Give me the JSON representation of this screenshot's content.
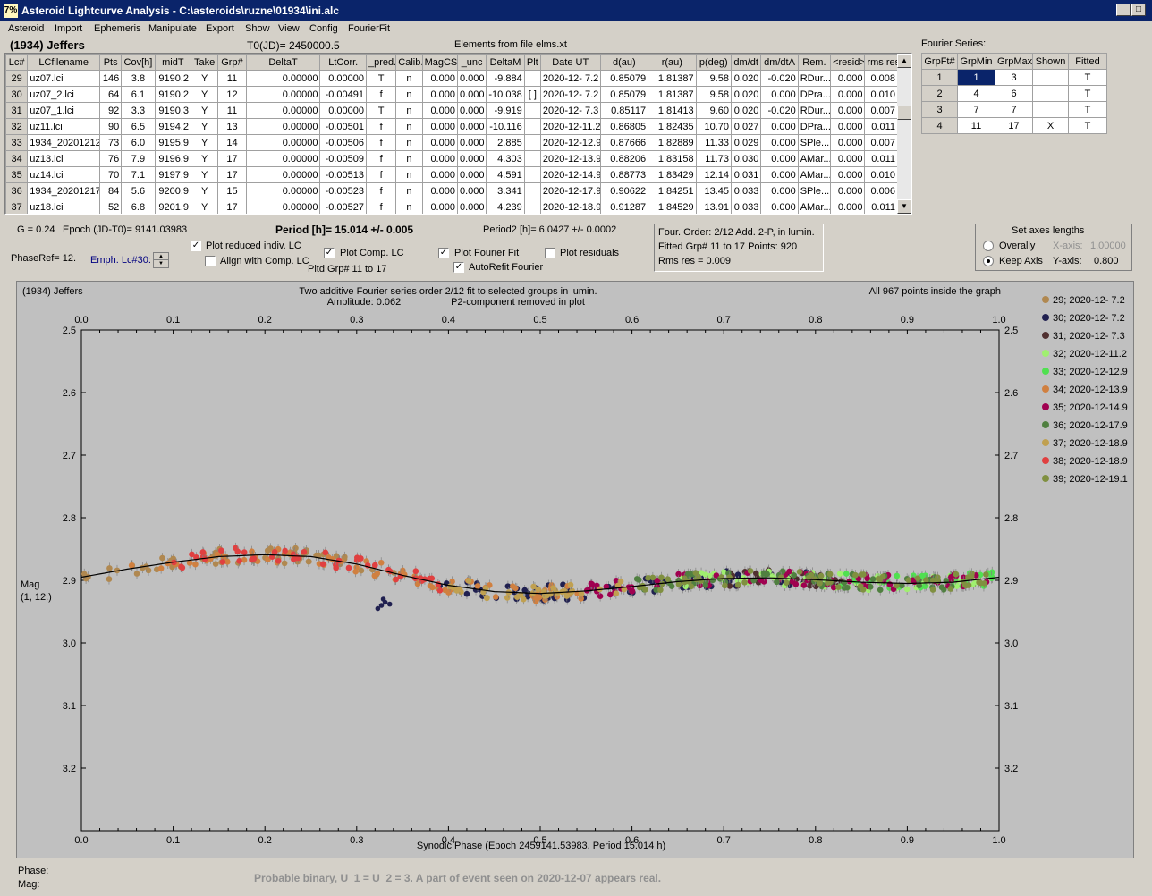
{
  "window": {
    "title": "Asteroid Lightcurve Analysis - C:\\asteroids\\ruzne\\01934\\ini.alc",
    "icon": "7%",
    "min": "_",
    "max": "□",
    "close": "×"
  },
  "menu": [
    "Asteroid",
    "Import",
    "Ephemeris",
    "Manipulate",
    "Export",
    "Show",
    "View",
    "Config",
    "FourierFit"
  ],
  "asteroid_name": "(1934) Jeffers",
  "t0": "T0(JD)= 2450000.5",
  "elements_label": "Elements from file elms.xt",
  "lc_table": {
    "columns": [
      "Lc#",
      "LCfilename",
      "Pts",
      "Cov[h]",
      "midT",
      "Take",
      "Grp#",
      "DeltaT",
      "LtCorr.",
      "_pred.",
      "Calib.",
      "MagCS",
      "_unc",
      "DeltaM",
      "Plt",
      "Date UT",
      "d(au)",
      "r(au)",
      "p(deg)",
      "dm/dt",
      "dm/dtA",
      "Rem.",
      "<resid>",
      "rms res"
    ],
    "rows": [
      [
        "29",
        "uz07.lci",
        "146",
        "3.8",
        "9190.2",
        "Y",
        "11",
        "0.00000",
        "0.00000",
        "T",
        "n",
        "0.000",
        "0.000",
        "-9.884",
        "",
        "2020-12- 7.2",
        "0.85079",
        "1.81387",
        "9.58",
        "0.020",
        "-0.020",
        "RDur...",
        "0.000",
        "0.008"
      ],
      [
        "30",
        "uz07_2.lci",
        "64",
        "6.1",
        "9190.2",
        "Y",
        "12",
        "0.00000",
        "-0.00491",
        "f",
        "n",
        "0.000",
        "0.000",
        "-10.038",
        "[ ]",
        "2020-12- 7.2",
        "0.85079",
        "1.81387",
        "9.58",
        "0.020",
        "0.000",
        "DPra...",
        "0.000",
        "0.010"
      ],
      [
        "31",
        "uz07_1.lci",
        "92",
        "3.3",
        "9190.3",
        "Y",
        "11",
        "0.00000",
        "0.00000",
        "T",
        "n",
        "0.000",
        "0.000",
        "-9.919",
        "",
        "2020-12- 7.3",
        "0.85117",
        "1.81413",
        "9.60",
        "0.020",
        "-0.020",
        "RDur...",
        "0.000",
        "0.007"
      ],
      [
        "32",
        "uz11.lci",
        "90",
        "6.5",
        "9194.2",
        "Y",
        "13",
        "0.00000",
        "-0.00501",
        "f",
        "n",
        "0.000",
        "0.000",
        "-10.116",
        "",
        "2020-12-11.2",
        "0.86805",
        "1.82435",
        "10.70",
        "0.027",
        "0.000",
        "DPra...",
        "0.000",
        "0.011"
      ],
      [
        "33",
        "1934_20201212",
        "73",
        "6.0",
        "9195.9",
        "Y",
        "14",
        "0.00000",
        "-0.00506",
        "f",
        "n",
        "0.000",
        "0.000",
        "2.885",
        "",
        "2020-12-12.9",
        "0.87666",
        "1.82889",
        "11.33",
        "0.029",
        "0.000",
        "SPle...",
        "0.000",
        "0.007"
      ],
      [
        "34",
        "uz13.lci",
        "76",
        "7.9",
        "9196.9",
        "Y",
        "17",
        "0.00000",
        "-0.00509",
        "f",
        "n",
        "0.000",
        "0.000",
        "4.303",
        "",
        "2020-12-13.9",
        "0.88206",
        "1.83158",
        "11.73",
        "0.030",
        "0.000",
        "AMar...",
        "0.000",
        "0.011"
      ],
      [
        "35",
        "uz14.lci",
        "70",
        "7.1",
        "9197.9",
        "Y",
        "17",
        "0.00000",
        "-0.00513",
        "f",
        "n",
        "0.000",
        "0.000",
        "4.591",
        "",
        "2020-12-14.9",
        "0.88773",
        "1.83429",
        "12.14",
        "0.031",
        "0.000",
        "AMar...",
        "0.000",
        "0.010"
      ],
      [
        "36",
        "1934_20201217",
        "84",
        "5.6",
        "9200.9",
        "Y",
        "15",
        "0.00000",
        "-0.00523",
        "f",
        "n",
        "0.000",
        "0.000",
        "3.341",
        "",
        "2020-12-17.9",
        "0.90622",
        "1.84251",
        "13.45",
        "0.033",
        "0.000",
        "SPle...",
        "0.000",
        "0.006"
      ],
      [
        "37",
        "uz18.lci",
        "52",
        "6.8",
        "9201.9",
        "Y",
        "17",
        "0.00000",
        "-0.00527",
        "f",
        "n",
        "0.000",
        "0.000",
        "4.239",
        "",
        "2020-12-18.9",
        "0.91287",
        "1.84529",
        "13.91",
        "0.033",
        "0.000",
        "AMar...",
        "0.000",
        "0.011"
      ]
    ]
  },
  "fourier_series": {
    "label": "Fourier Series:",
    "columns": [
      "GrpFt#",
      "GrpMin",
      "GrpMax",
      "Shown",
      "Fitted"
    ],
    "rows": [
      [
        "1",
        "1",
        "3",
        "",
        "T"
      ],
      [
        "2",
        "4",
        "6",
        "",
        "T"
      ],
      [
        "3",
        "7",
        "7",
        "",
        "T"
      ],
      [
        "4",
        "11",
        "17",
        "X",
        "T"
      ]
    ]
  },
  "params": {
    "g": "G = 0.24",
    "epoch": "Epoch (JD-T0)= 9141.03983",
    "period": "Period [h]= 15.014 +/- 0.005",
    "period2": "Period2 [h]= 6.0427 +/- 0.0002",
    "phaseref": "PhaseRef= 12.",
    "emph": "Emph. Lc#30:",
    "pltd_grp": "Pltd Grp#  11 to   17"
  },
  "options": {
    "plot_reduced": "Plot reduced indiv. LC",
    "align_comp": "Align with Comp. LC",
    "plot_comp": "Plot Comp. LC",
    "plot_fourier": "Plot Fourier Fit",
    "autorefit": "AutoRefit Fourier",
    "plot_residuals": "Plot residuals",
    "check": "✓"
  },
  "fit_info": {
    "line1": "Four. Order:  2/12    Add. 2-P, in lumin.",
    "line2": "Fitted Grp# 11 to 17 Points: 920",
    "line3": "Rms res      = 0.009"
  },
  "axes_box": {
    "title": "Set axes lengths",
    "overally": "Overally",
    "keep_axis": "Keep Axis",
    "x_label": "X-axis:",
    "x_val": "1.00000",
    "y_label": "Y-axis:",
    "y_val": "0.800"
  },
  "plot": {
    "name": "(1934) Jeffers",
    "title1": "Two additive Fourier series order 2/12 fit to selected groups in lumin.",
    "title2_a": "Amplitude: 0.062",
    "title2_b": "P2-component removed in plot",
    "inside": "All 967 points inside the graph",
    "ylabel1": "Mag",
    "ylabel2": "(1, 12.)",
    "xlabel": "Synodic Phase (Epoch 2459141.53983, Period 15.014 h)"
  },
  "chart_data": {
    "type": "scatter",
    "xlim": [
      0.0,
      1.0
    ],
    "ylim": [
      3.3,
      2.5
    ],
    "x_ticks": [
      "0.0",
      "0.1",
      "0.2",
      "0.3",
      "0.4",
      "0.5",
      "0.6",
      "0.7",
      "0.8",
      "0.9",
      "1.0"
    ],
    "y_ticks": [
      "2.5",
      "2.6",
      "2.7",
      "2.8",
      "2.9",
      "3.0",
      "3.1",
      "3.2"
    ],
    "fit_curve": {
      "x": [
        0.0,
        0.05,
        0.1,
        0.15,
        0.2,
        0.25,
        0.3,
        0.35,
        0.4,
        0.45,
        0.5,
        0.55,
        0.6,
        0.65,
        0.7,
        0.75,
        0.8,
        0.85,
        0.9,
        0.95,
        1.0
      ],
      "y": [
        2.895,
        2.882,
        2.871,
        2.862,
        2.859,
        2.862,
        2.874,
        2.892,
        2.908,
        2.918,
        2.921,
        2.917,
        2.91,
        2.902,
        2.897,
        2.896,
        2.899,
        2.903,
        2.905,
        2.903,
        2.895
      ]
    },
    "series": [
      {
        "name": "29; 2020-12- 7.2",
        "color": "#b08850",
        "x_range": [
          0.0,
          0.35
        ]
      },
      {
        "name": "30; 2020-12- 7.2",
        "color": "#202050",
        "x_range": [
          0.38,
          0.8
        ]
      },
      {
        "name": "31; 2020-12- 7.3",
        "color": "#503030",
        "x_range": [
          0.7,
          0.85
        ]
      },
      {
        "name": "32; 2020-12-11.2",
        "color": "#a0f070",
        "x_range": [
          0.65,
          0.98
        ]
      },
      {
        "name": "33; 2020-12-12.9",
        "color": "#50e050",
        "x_range": [
          0.8,
          1.0
        ]
      },
      {
        "name": "34; 2020-12-13.9",
        "color": "#d08040",
        "x_range": [
          0.05,
          0.55
        ]
      },
      {
        "name": "35; 2020-12-14.9",
        "color": "#a00050",
        "x_range": [
          0.55,
          1.0
        ]
      },
      {
        "name": "36; 2020-12-17.9",
        "color": "#508040",
        "x_range": [
          0.6,
          0.95
        ]
      },
      {
        "name": "37; 2020-12-18.9",
        "color": "#c0a050",
        "x_range": [
          0.4,
          0.6
        ]
      },
      {
        "name": "38; 2020-12-18.9",
        "color": "#e04040",
        "x_range": [
          0.1,
          0.4
        ]
      },
      {
        "name": "39; 2020-12-19.1",
        "color": "#809040",
        "x_range": [
          0.6,
          1.0
        ]
      }
    ]
  },
  "footer": {
    "phase": "Phase:",
    "mag": "Mag:",
    "note": "Probable binary, U_1 = U_2 = 3.  A part of event seen on 2020-12-07 appears real."
  }
}
